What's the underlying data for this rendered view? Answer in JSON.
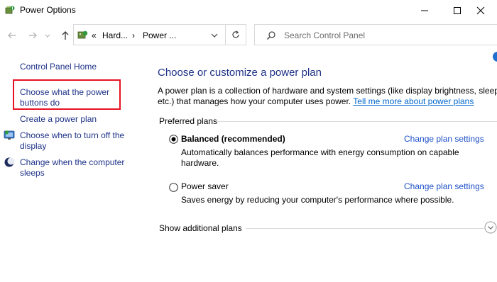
{
  "window": {
    "title": "Power Options",
    "icons": {
      "app": "power-options-icon",
      "minimize": "minimize-icon",
      "maximize": "maximize-icon",
      "close": "close-icon"
    }
  },
  "address": {
    "crumb_prefix": "«",
    "crumb1": "Hard...",
    "separator": "›",
    "crumb2": "Power ..."
  },
  "search": {
    "placeholder": "Search Control Panel"
  },
  "sidebar": {
    "home": "Control Panel Home",
    "links": [
      {
        "label1": "Choose what the power",
        "label2": "buttons do"
      },
      {
        "label1": "Create a power plan"
      },
      {
        "label1": "Choose when to turn off the",
        "label2": "display",
        "icon": "display-icon"
      },
      {
        "label1": "Change when the computer",
        "label2": "sleeps",
        "icon": "moon-icon"
      }
    ]
  },
  "main": {
    "heading": "Choose or customize a power plan",
    "desc_line1": "A power plan is a collection of hardware and system settings (like display brightness, sleep,",
    "desc_line2_prefix": "etc.) that manages how your computer uses power. ",
    "desc_link": "Tell me more about power plans",
    "preferred_label": "Preferred plans",
    "plans": [
      {
        "name": "Balanced (recommended)",
        "selected": true,
        "desc1": "Automatically balances performance with energy consumption on capable",
        "desc2": "hardware.",
        "link": "Change plan settings"
      },
      {
        "name": "Power saver",
        "selected": false,
        "desc1": "Saves energy by reducing your computer's performance where possible.",
        "link": "Change plan settings"
      }
    ],
    "show_more": "Show additional plans"
  },
  "colors": {
    "link_dark": "#1e3287",
    "link_blue": "#1e50c8",
    "highlight": "#e81123"
  }
}
